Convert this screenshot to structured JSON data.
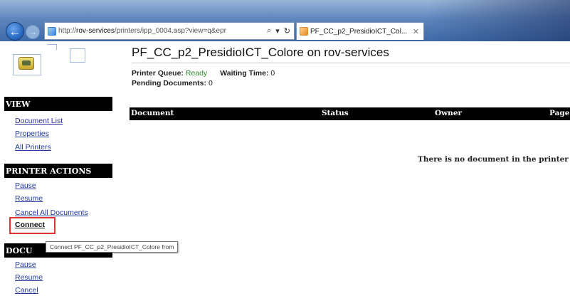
{
  "browser": {
    "url_prefix": "http://",
    "url_host": "rov-services",
    "url_path": "/printers/ipp_0004.asp?view=q&epr",
    "tab_title": "PF_CC_p2_PresidioICT_Col...",
    "address_icons": [
      "search-icon",
      "dropdown-icon",
      "refresh-icon"
    ]
  },
  "sidebar": {
    "view_heading": "VIEW",
    "view_links": [
      "Document List",
      "Properties",
      "All Printers"
    ],
    "printer_actions_heading": "PRINTER ACTIONS",
    "printer_actions": [
      "Pause",
      "Resume",
      "Cancel All Documents",
      "Connect"
    ],
    "document_actions_heading": "DOCU",
    "document_actions": [
      "Pause",
      "Resume",
      "Cancel"
    ]
  },
  "tooltip": "Connect PF_CC_p2_PresidioICT_Colore from",
  "main": {
    "title": "PF_CC_p2_PresidioICT_Colore on rov-services",
    "queue_label": "Printer Queue:",
    "queue_value": "Ready",
    "waiting_label": "Waiting Time:",
    "waiting_value": "0",
    "pending_label": "Pending Documents:",
    "pending_value": "0",
    "columns": [
      "Document",
      "Status",
      "Owner",
      "Page"
    ],
    "empty_message": "There is no document in the printer"
  },
  "colors": {
    "accent_link": "#223b9c",
    "header_bg": "#000000",
    "ready_green": "#2a8a2a",
    "highlight_red": "#e03434"
  }
}
